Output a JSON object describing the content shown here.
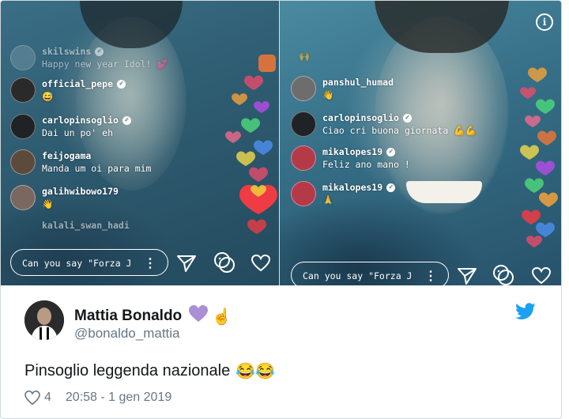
{
  "video_left": {
    "comments": [
      {
        "username": "skilswins",
        "text": "Happy new year Idol!",
        "verified": true,
        "faded": true
      },
      {
        "username": "official_pepe",
        "text": "",
        "verified": true,
        "emoji": "grinning-face"
      },
      {
        "username": "carlopinsoglio",
        "text": "Dai un po' eh",
        "verified": true
      },
      {
        "username": "feijogama",
        "text": "Manda um oi para mim",
        "verified": false
      },
      {
        "username": "galihwibowo179",
        "text": "",
        "verified": false,
        "emoji": "waving-hand"
      },
      {
        "username": "kalali_swan_hadi",
        "text": "",
        "verified": false,
        "faded": true
      }
    ],
    "input_placeholder": "Can you say \"Forza J"
  },
  "video_right": {
    "comments": [
      {
        "username": "panshul_humad",
        "text": "",
        "verified": false,
        "emoji": "waving-hand"
      },
      {
        "username": "carlopinsoglio",
        "text": "Ciao cri buona giornata",
        "verified": true,
        "emoji": "flexed-biceps"
      },
      {
        "username": "mikalopes19",
        "text": "Feliz ano mano !",
        "verified": true
      },
      {
        "username": "mikalopes19",
        "text": "",
        "verified": true,
        "emoji": "folded-hands"
      }
    ],
    "input_placeholder": "Can you say \"Forza J"
  },
  "tweet": {
    "author_name": "Mattia Bonaldo",
    "author_handle": "@bonaldo_mattia",
    "name_emojis": [
      "purple-heart",
      "index-pointing-up"
    ],
    "text": "Pinsoglio leggenda nazionale",
    "text_emojis": [
      "face-with-tears-of-joy",
      "face-with-tears-of-joy"
    ],
    "like_count": "4",
    "timestamp": "20:58 - 1 gen 2019"
  },
  "colors": {
    "twitter_blue": "#1da1f2",
    "handle_gray": "#657786",
    "text_dark": "#14171a",
    "card_border": "#cfd9de"
  },
  "icons": [
    "info-icon",
    "send-icon",
    "face-filter-icon",
    "heart-outline-icon",
    "twitter-bird-icon",
    "like-heart-icon"
  ]
}
